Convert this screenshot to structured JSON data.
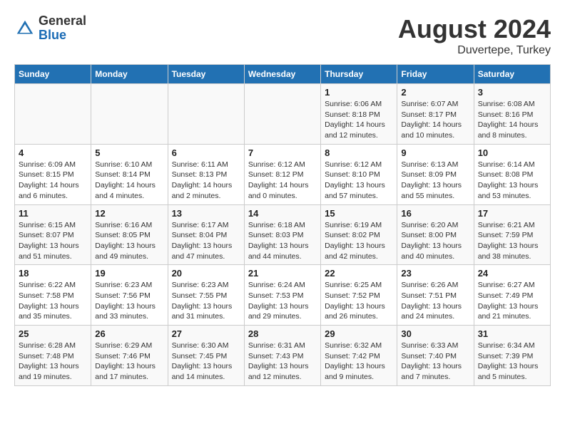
{
  "header": {
    "logo_general": "General",
    "logo_blue": "Blue",
    "title": "August 2024",
    "subtitle": "Duvertepe, Turkey"
  },
  "days_of_week": [
    "Sunday",
    "Monday",
    "Tuesday",
    "Wednesday",
    "Thursday",
    "Friday",
    "Saturday"
  ],
  "weeks": [
    {
      "days": [
        {
          "number": "",
          "info": ""
        },
        {
          "number": "",
          "info": ""
        },
        {
          "number": "",
          "info": ""
        },
        {
          "number": "",
          "info": ""
        },
        {
          "number": "1",
          "info": "Sunrise: 6:06 AM\nSunset: 8:18 PM\nDaylight: 14 hours\nand 12 minutes."
        },
        {
          "number": "2",
          "info": "Sunrise: 6:07 AM\nSunset: 8:17 PM\nDaylight: 14 hours\nand 10 minutes."
        },
        {
          "number": "3",
          "info": "Sunrise: 6:08 AM\nSunset: 8:16 PM\nDaylight: 14 hours\nand 8 minutes."
        }
      ]
    },
    {
      "days": [
        {
          "number": "4",
          "info": "Sunrise: 6:09 AM\nSunset: 8:15 PM\nDaylight: 14 hours\nand 6 minutes."
        },
        {
          "number": "5",
          "info": "Sunrise: 6:10 AM\nSunset: 8:14 PM\nDaylight: 14 hours\nand 4 minutes."
        },
        {
          "number": "6",
          "info": "Sunrise: 6:11 AM\nSunset: 8:13 PM\nDaylight: 14 hours\nand 2 minutes."
        },
        {
          "number": "7",
          "info": "Sunrise: 6:12 AM\nSunset: 8:12 PM\nDaylight: 14 hours\nand 0 minutes."
        },
        {
          "number": "8",
          "info": "Sunrise: 6:12 AM\nSunset: 8:10 PM\nDaylight: 13 hours\nand 57 minutes."
        },
        {
          "number": "9",
          "info": "Sunrise: 6:13 AM\nSunset: 8:09 PM\nDaylight: 13 hours\nand 55 minutes."
        },
        {
          "number": "10",
          "info": "Sunrise: 6:14 AM\nSunset: 8:08 PM\nDaylight: 13 hours\nand 53 minutes."
        }
      ]
    },
    {
      "days": [
        {
          "number": "11",
          "info": "Sunrise: 6:15 AM\nSunset: 8:07 PM\nDaylight: 13 hours\nand 51 minutes."
        },
        {
          "number": "12",
          "info": "Sunrise: 6:16 AM\nSunset: 8:05 PM\nDaylight: 13 hours\nand 49 minutes."
        },
        {
          "number": "13",
          "info": "Sunrise: 6:17 AM\nSunset: 8:04 PM\nDaylight: 13 hours\nand 47 minutes."
        },
        {
          "number": "14",
          "info": "Sunrise: 6:18 AM\nSunset: 8:03 PM\nDaylight: 13 hours\nand 44 minutes."
        },
        {
          "number": "15",
          "info": "Sunrise: 6:19 AM\nSunset: 8:02 PM\nDaylight: 13 hours\nand 42 minutes."
        },
        {
          "number": "16",
          "info": "Sunrise: 6:20 AM\nSunset: 8:00 PM\nDaylight: 13 hours\nand 40 minutes."
        },
        {
          "number": "17",
          "info": "Sunrise: 6:21 AM\nSunset: 7:59 PM\nDaylight: 13 hours\nand 38 minutes."
        }
      ]
    },
    {
      "days": [
        {
          "number": "18",
          "info": "Sunrise: 6:22 AM\nSunset: 7:58 PM\nDaylight: 13 hours\nand 35 minutes."
        },
        {
          "number": "19",
          "info": "Sunrise: 6:23 AM\nSunset: 7:56 PM\nDaylight: 13 hours\nand 33 minutes."
        },
        {
          "number": "20",
          "info": "Sunrise: 6:23 AM\nSunset: 7:55 PM\nDaylight: 13 hours\nand 31 minutes."
        },
        {
          "number": "21",
          "info": "Sunrise: 6:24 AM\nSunset: 7:53 PM\nDaylight: 13 hours\nand 29 minutes."
        },
        {
          "number": "22",
          "info": "Sunrise: 6:25 AM\nSunset: 7:52 PM\nDaylight: 13 hours\nand 26 minutes."
        },
        {
          "number": "23",
          "info": "Sunrise: 6:26 AM\nSunset: 7:51 PM\nDaylight: 13 hours\nand 24 minutes."
        },
        {
          "number": "24",
          "info": "Sunrise: 6:27 AM\nSunset: 7:49 PM\nDaylight: 13 hours\nand 21 minutes."
        }
      ]
    },
    {
      "days": [
        {
          "number": "25",
          "info": "Sunrise: 6:28 AM\nSunset: 7:48 PM\nDaylight: 13 hours\nand 19 minutes."
        },
        {
          "number": "26",
          "info": "Sunrise: 6:29 AM\nSunset: 7:46 PM\nDaylight: 13 hours\nand 17 minutes."
        },
        {
          "number": "27",
          "info": "Sunrise: 6:30 AM\nSunset: 7:45 PM\nDaylight: 13 hours\nand 14 minutes."
        },
        {
          "number": "28",
          "info": "Sunrise: 6:31 AM\nSunset: 7:43 PM\nDaylight: 13 hours\nand 12 minutes."
        },
        {
          "number": "29",
          "info": "Sunrise: 6:32 AM\nSunset: 7:42 PM\nDaylight: 13 hours\nand 9 minutes."
        },
        {
          "number": "30",
          "info": "Sunrise: 6:33 AM\nSunset: 7:40 PM\nDaylight: 13 hours\nand 7 minutes."
        },
        {
          "number": "31",
          "info": "Sunrise: 6:34 AM\nSunset: 7:39 PM\nDaylight: 13 hours\nand 5 minutes."
        }
      ]
    }
  ]
}
